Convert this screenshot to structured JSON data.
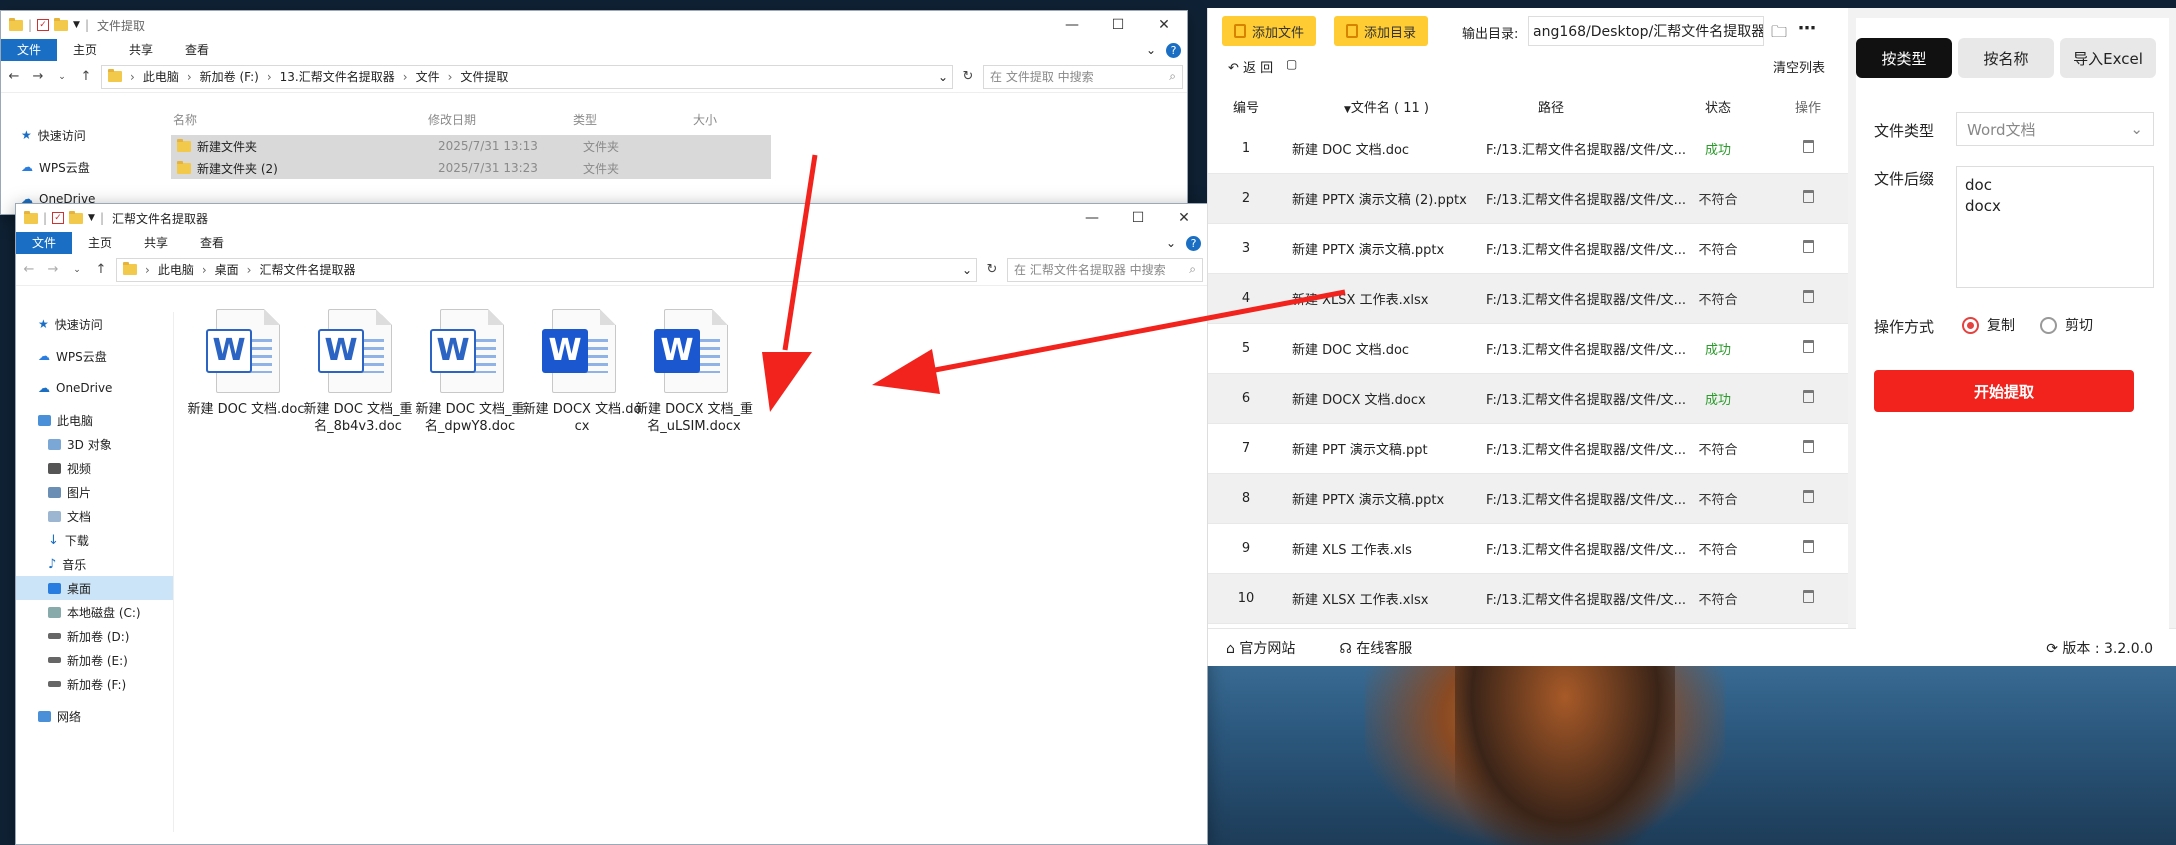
{
  "explorer_back": {
    "title": "文件提取",
    "ribbon_tabs": [
      "文件",
      "主页",
      "共享",
      "查看"
    ],
    "breadcrumb": [
      "此电脑",
      "新加卷 (F:)",
      "13.汇帮文件名提取器",
      "文件",
      "文件提取"
    ],
    "search_placeholder": "在 文件提取 中搜索",
    "columns": [
      "名称",
      "修改日期",
      "类型",
      "大小"
    ],
    "nav": [
      "快速访问",
      "WPS云盘",
      "OneDrive"
    ],
    "files": [
      {
        "name": "新建文件夹",
        "date": "2025/7/31 13:13",
        "type": "文件夹"
      },
      {
        "name": "新建文件夹 (2)",
        "date": "2025/7/31 13:23",
        "type": "文件夹"
      }
    ]
  },
  "explorer_front": {
    "title": "汇帮文件名提取器",
    "ribbon_tabs": [
      "文件",
      "主页",
      "共享",
      "查看"
    ],
    "breadcrumb": [
      "此电脑",
      "桌面",
      "汇帮文件名提取器"
    ],
    "search_placeholder": "在 汇帮文件名提取器 中搜索",
    "nav": [
      "快速访问",
      "WPS云盘",
      "OneDrive",
      "此电脑",
      "3D 对象",
      "视频",
      "图片",
      "文档",
      "下载",
      "音乐",
      "桌面",
      "本地磁盘 (C:)",
      "新加卷 (D:)",
      "新加卷 (E:)",
      "新加卷 (F:)",
      "网络"
    ],
    "files": [
      {
        "name": "新建 DOC 文档.doc",
        "kind": "old"
      },
      {
        "name": "新建 DOC 文档_重名_8b4v3.doc",
        "kind": "old"
      },
      {
        "name": "新建 DOC 文档_重名_dpwY8.doc",
        "kind": "old"
      },
      {
        "name": "新建 DOCX 文档.docx",
        "kind": "new"
      },
      {
        "name": "新建 DOCX 文档_重名_uLSIM.docx",
        "kind": "new"
      }
    ]
  },
  "app": {
    "add_file": "添加文件",
    "add_dir": "添加目录",
    "output_label": "输出目录:",
    "output_path": "ang168/Desktop/汇帮文件名提取器",
    "back_label": "返 回",
    "clear_label": "清空列表",
    "headers": {
      "num": "编号",
      "name": "文件名 ( 11 )",
      "path": "路径",
      "status": "状态",
      "op": "操作"
    },
    "rows": [
      {
        "num": "1",
        "name": "新建 DOC 文档.doc",
        "path": "F:/13.汇帮文件名提取器/文件/文...",
        "status": "成功"
      },
      {
        "num": "2",
        "name": "新建 PPTX 演示文稿 (2).pptx",
        "path": "F:/13.汇帮文件名提取器/文件/文...",
        "status": "不符合"
      },
      {
        "num": "3",
        "name": "新建 PPTX 演示文稿.pptx",
        "path": "F:/13.汇帮文件名提取器/文件/文...",
        "status": "不符合"
      },
      {
        "num": "4",
        "name": "新建 XLSX 工作表.xlsx",
        "path": "F:/13.汇帮文件名提取器/文件/文...",
        "status": "不符合"
      },
      {
        "num": "5",
        "name": "新建 DOC 文档.doc",
        "path": "F:/13.汇帮文件名提取器/文件/文...",
        "status": "成功"
      },
      {
        "num": "6",
        "name": "新建 DOCX 文档.docx",
        "path": "F:/13.汇帮文件名提取器/文件/文...",
        "status": "成功"
      },
      {
        "num": "7",
        "name": "新建 PPT 演示文稿.ppt",
        "path": "F:/13.汇帮文件名提取器/文件/文...",
        "status": "不符合"
      },
      {
        "num": "8",
        "name": "新建 PPTX 演示文稿.pptx",
        "path": "F:/13.汇帮文件名提取器/文件/文...",
        "status": "不符合"
      },
      {
        "num": "9",
        "name": "新建 XLS 工作表.xls",
        "path": "F:/13.汇帮文件名提取器/文件/文...",
        "status": "不符合"
      },
      {
        "num": "10",
        "name": "新建 XLSX 工作表.xlsx",
        "path": "F:/13.汇帮文件名提取器/文件/文...",
        "status": "不符合"
      }
    ],
    "footer_site": "官方网站",
    "footer_service": "在线客服",
    "version": "版本 : 3.2.0.0",
    "tabs": [
      "按类型",
      "按名称",
      "导入Excel"
    ],
    "type_label": "文件类型",
    "type_value": "Word文档",
    "suffix_label": "文件后缀",
    "suffix_value": "doc\ndocx",
    "op_label": "操作方式",
    "op_copy": "复制",
    "op_cut": "剪切",
    "start_button": "开始提取",
    "colors": {
      "accent_red": "#f2231c",
      "yellow": "#ffcc33",
      "ok_green": "#2a9a2a"
    }
  }
}
